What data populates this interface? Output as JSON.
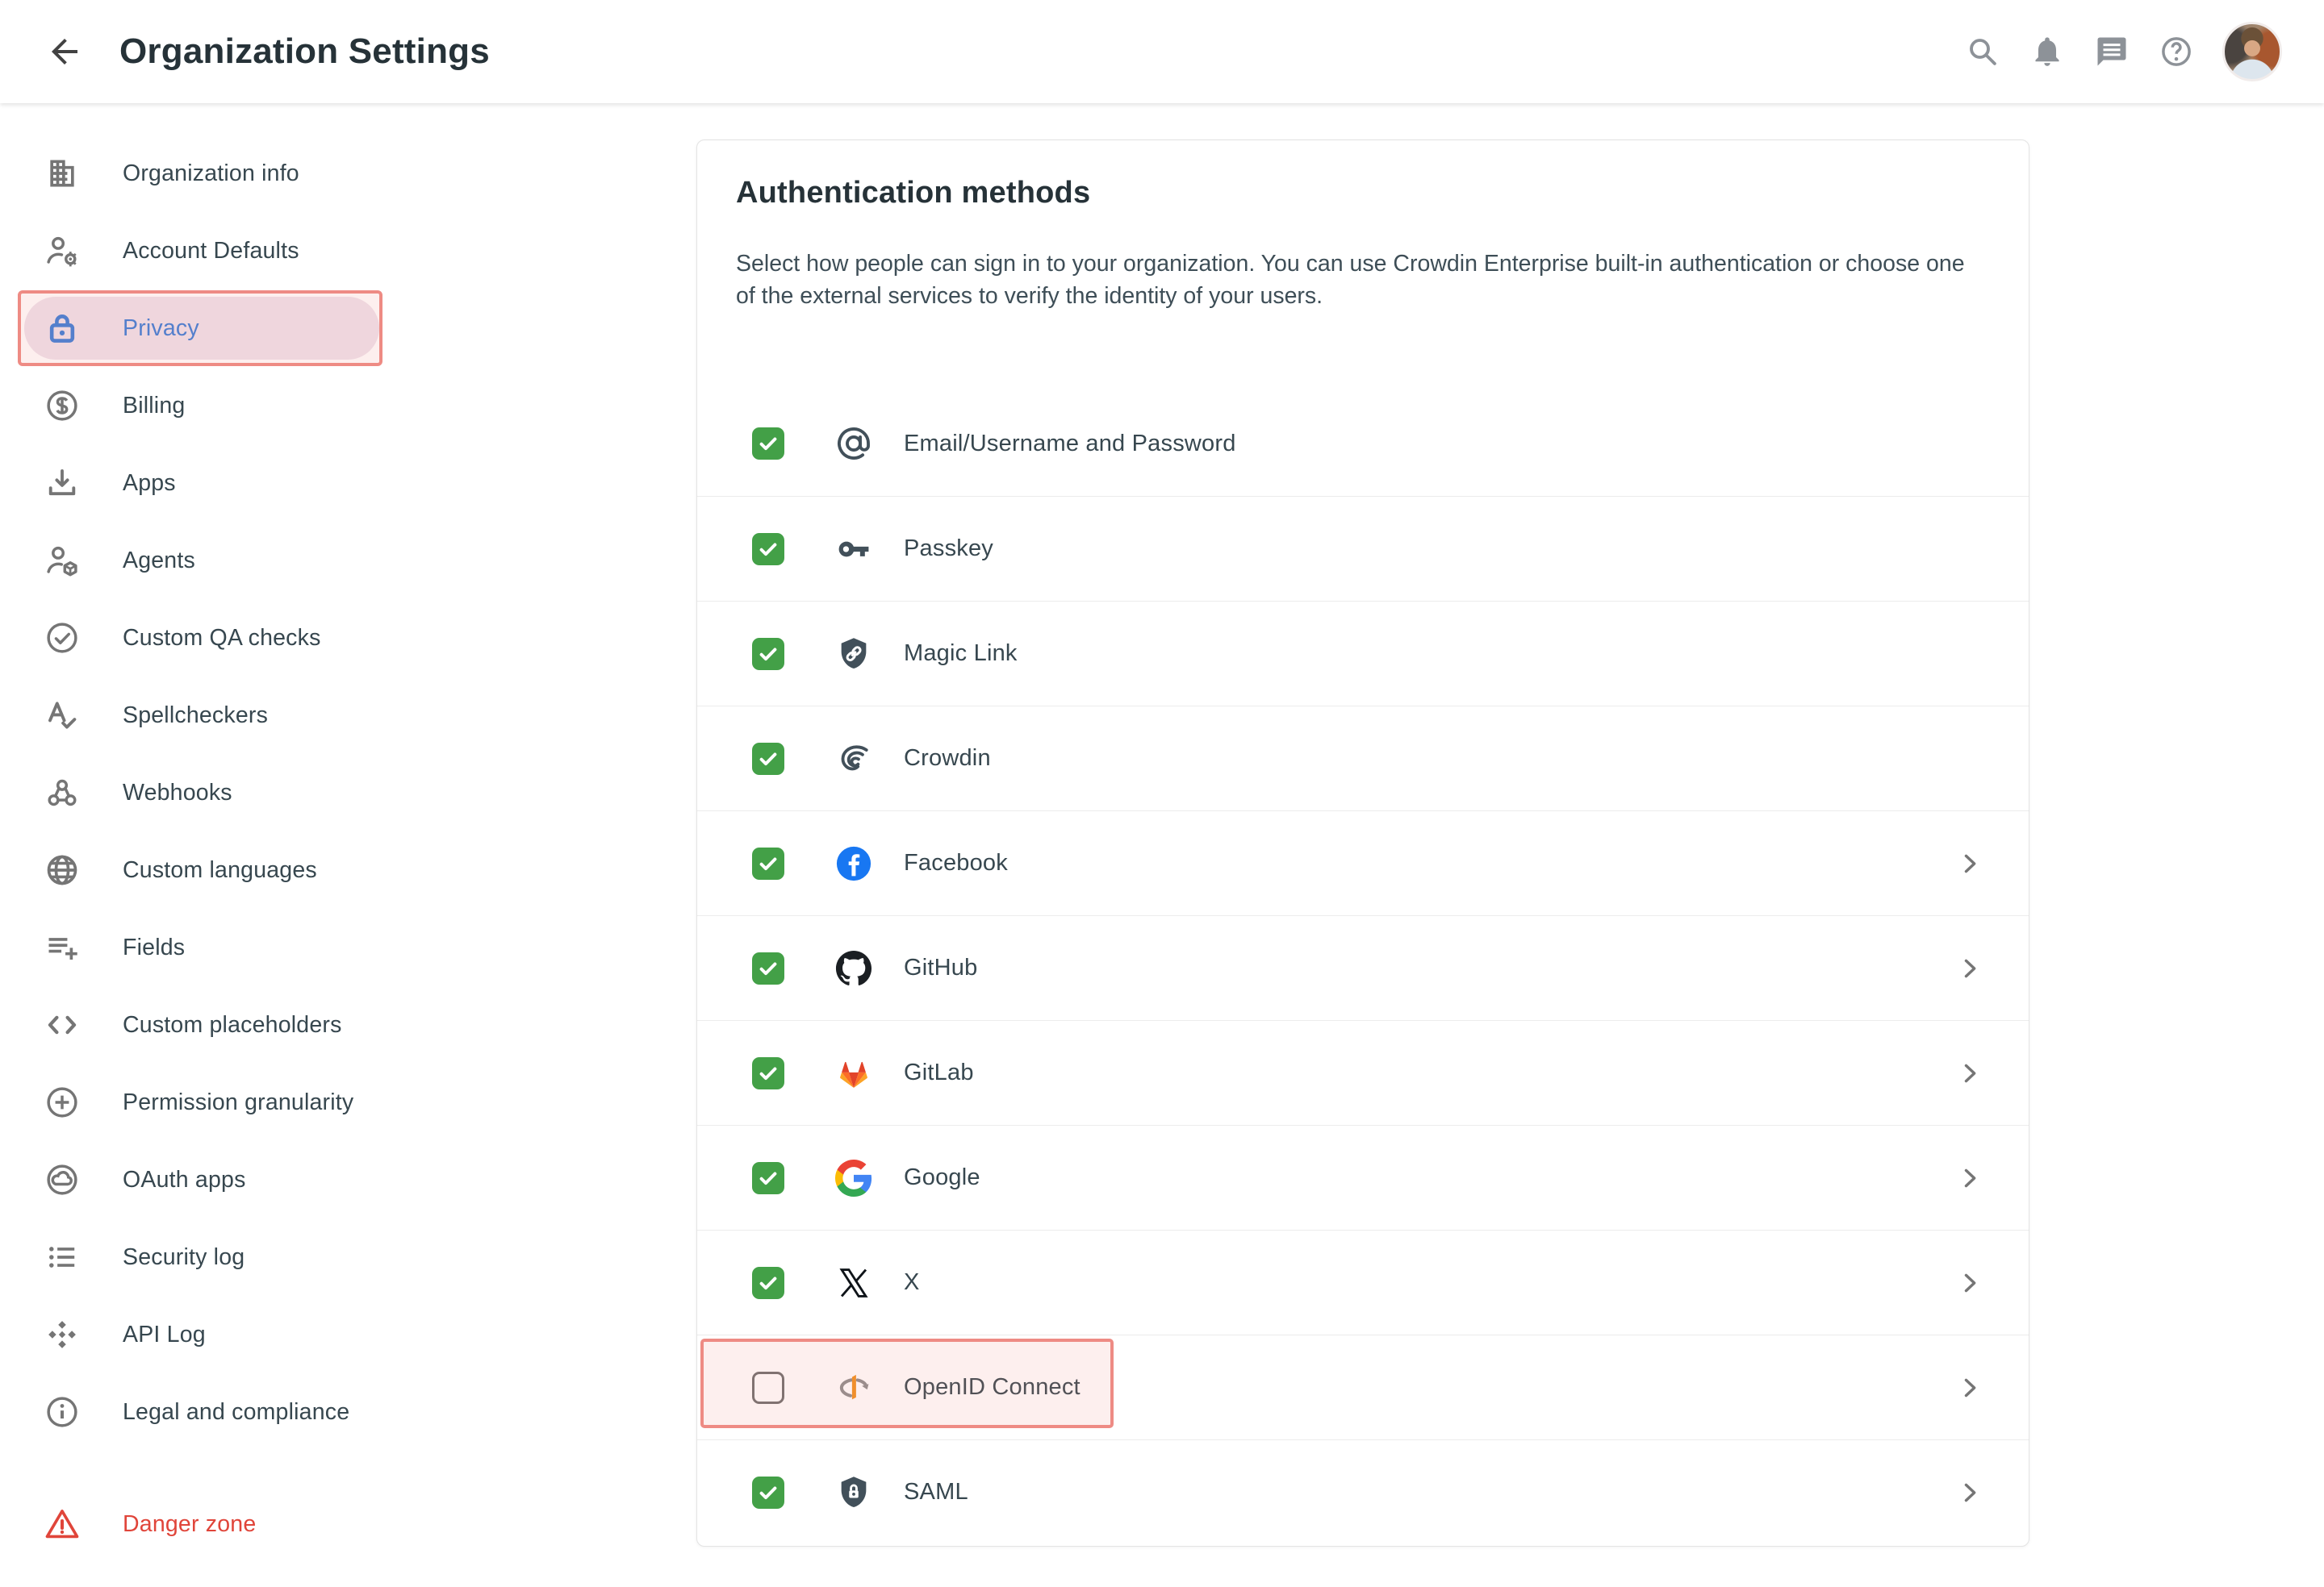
{
  "colors": {
    "accent_green": "#43a047",
    "active_blue": "#3b7dd8",
    "danger_red": "#e0453a",
    "annotation_pink": "#ee8b84"
  },
  "header": {
    "title": "Organization Settings",
    "back_icon": "arrow-back",
    "actions": [
      {
        "id": "search",
        "icon": "search"
      },
      {
        "id": "notifications",
        "icon": "bell"
      },
      {
        "id": "messages",
        "icon": "chat"
      },
      {
        "id": "help",
        "icon": "help"
      }
    ],
    "avatar_alt": "User avatar"
  },
  "sidebar": {
    "items": [
      {
        "id": "organization-info",
        "label": "Organization info",
        "icon": "building"
      },
      {
        "id": "account-defaults",
        "label": "Account Defaults",
        "icon": "person-gear"
      },
      {
        "id": "privacy",
        "label": "Privacy",
        "icon": "lock",
        "active": true,
        "annotated": true
      },
      {
        "id": "billing",
        "label": "Billing",
        "icon": "dollar-circle"
      },
      {
        "id": "apps",
        "label": "Apps",
        "icon": "download"
      },
      {
        "id": "agents",
        "label": "Agents",
        "icon": "person-cube"
      },
      {
        "id": "custom-qa-checks",
        "label": "Custom QA checks",
        "icon": "check-circle"
      },
      {
        "id": "spellcheckers",
        "label": "Spellcheckers",
        "icon": "spellcheck"
      },
      {
        "id": "webhooks",
        "label": "Webhooks",
        "icon": "webhook"
      },
      {
        "id": "custom-languages",
        "label": "Custom languages",
        "icon": "globe"
      },
      {
        "id": "fields",
        "label": "Fields",
        "icon": "list-plus"
      },
      {
        "id": "custom-placeholders",
        "label": "Custom placeholders",
        "icon": "code-brackets"
      },
      {
        "id": "permission-granularity",
        "label": "Permission granularity",
        "icon": "plus-circle"
      },
      {
        "id": "oauth-apps",
        "label": "OAuth apps",
        "icon": "cloud-circle"
      },
      {
        "id": "security-log",
        "label": "Security log",
        "icon": "list-bullets"
      },
      {
        "id": "api-log",
        "label": "API Log",
        "icon": "diamonds"
      },
      {
        "id": "legal-and-compliance",
        "label": "Legal and compliance",
        "icon": "info-circle"
      },
      {
        "id": "danger-zone",
        "label": "Danger zone",
        "icon": "warning-triangle",
        "danger": true
      }
    ]
  },
  "panel": {
    "title": "Authentication methods",
    "description": "Select how people can sign in to your organization. You can use Crowdin Enterprise built-in authentication or choose one of the external services to verify the identity of your users.",
    "rows": [
      {
        "id": "email-password",
        "label": "Email/Username and Password",
        "icon": "at-sign",
        "checked": true,
        "chevron": false
      },
      {
        "id": "passkey",
        "label": "Passkey",
        "icon": "key",
        "checked": true,
        "chevron": false
      },
      {
        "id": "magic-link",
        "label": "Magic Link",
        "icon": "shield-link",
        "checked": true,
        "chevron": false
      },
      {
        "id": "crowdin",
        "label": "Crowdin",
        "icon": "crowdin",
        "checked": true,
        "chevron": false
      },
      {
        "id": "facebook",
        "label": "Facebook",
        "icon": "facebook",
        "checked": true,
        "chevron": true
      },
      {
        "id": "github",
        "label": "GitHub",
        "icon": "github",
        "checked": true,
        "chevron": true
      },
      {
        "id": "gitlab",
        "label": "GitLab",
        "icon": "gitlab",
        "checked": true,
        "chevron": true
      },
      {
        "id": "google",
        "label": "Google",
        "icon": "google",
        "checked": true,
        "chevron": true
      },
      {
        "id": "x",
        "label": "X",
        "icon": "x-logo",
        "checked": true,
        "chevron": true
      },
      {
        "id": "openid-connect",
        "label": "OpenID Connect",
        "icon": "openid",
        "checked": false,
        "chevron": true,
        "highlighted": true
      },
      {
        "id": "saml",
        "label": "SAML",
        "icon": "shield-lock",
        "checked": true,
        "chevron": true
      }
    ]
  }
}
